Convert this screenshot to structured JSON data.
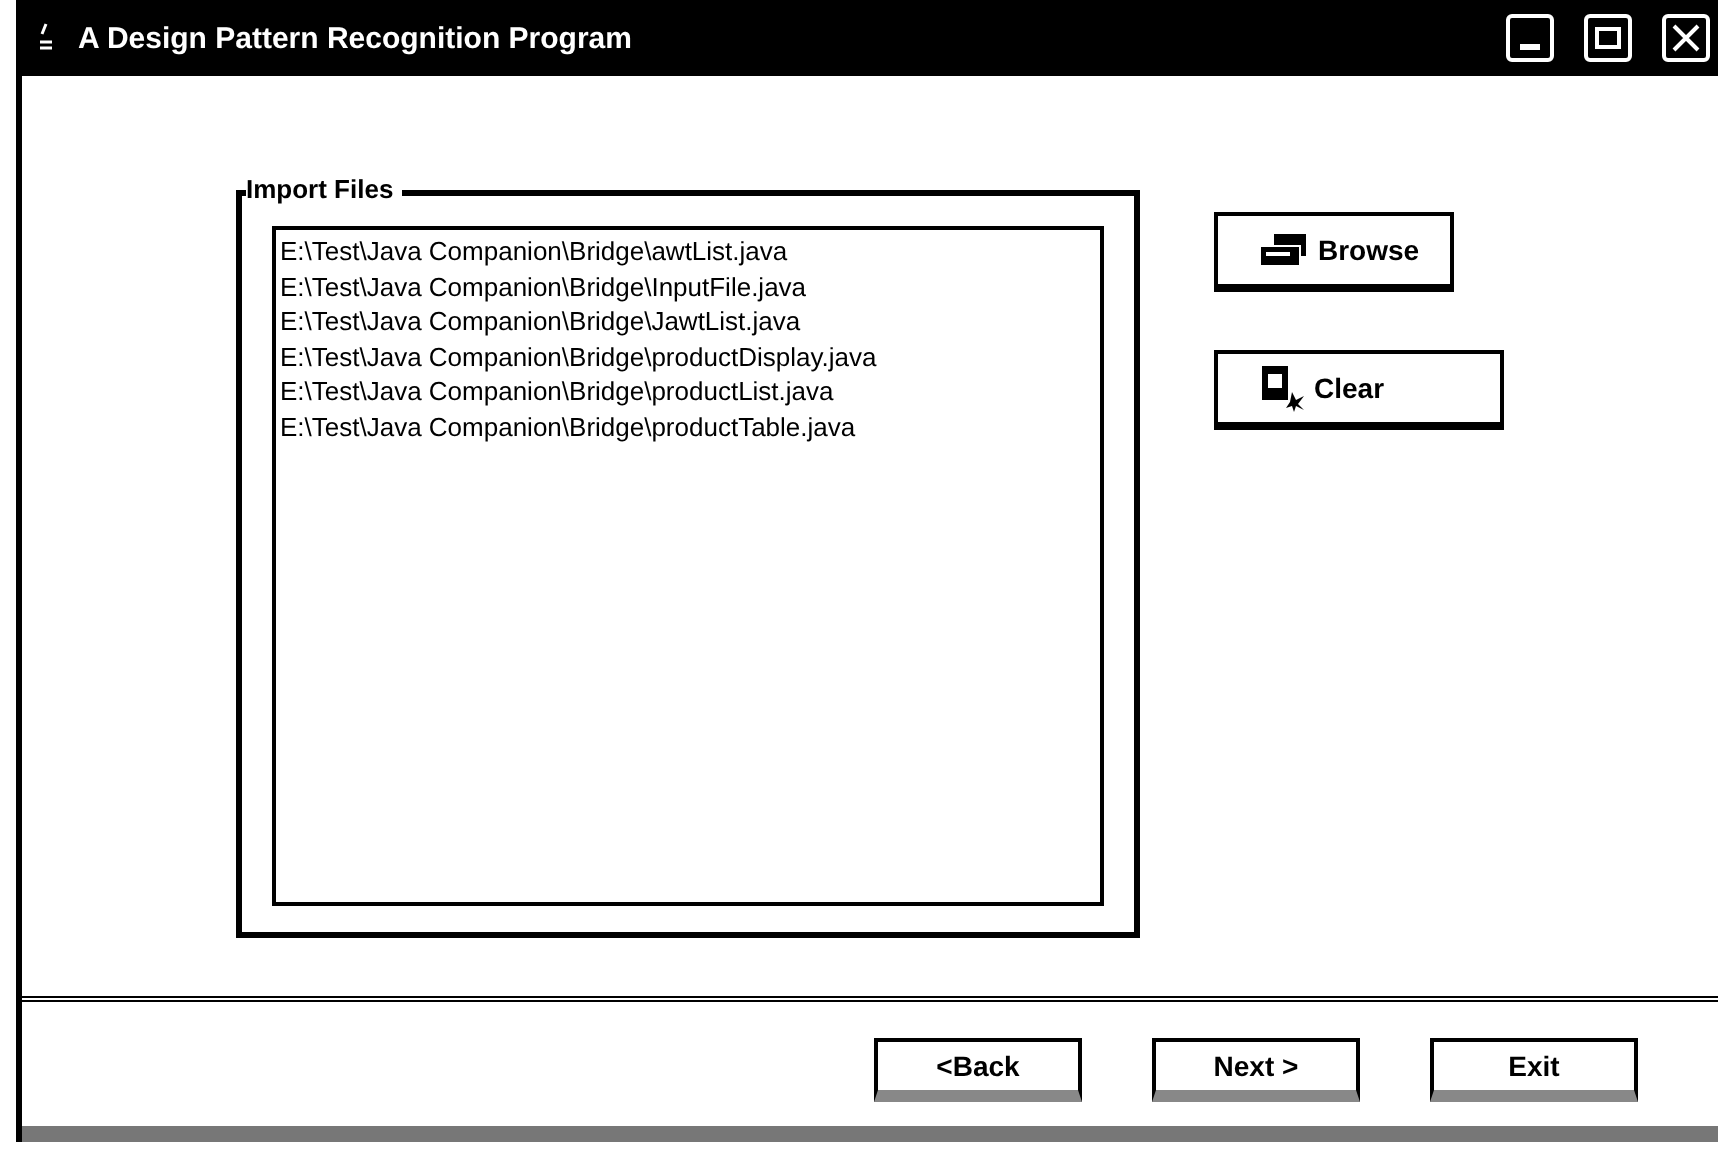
{
  "window": {
    "title": "A Design Pattern Recognition Program"
  },
  "import_files": {
    "label": "Import Files",
    "files": [
      "E:\\Test\\Java Companion\\Bridge\\awtList.java",
      "E:\\Test\\Java Companion\\Bridge\\InputFile.java",
      "E:\\Test\\Java Companion\\Bridge\\JawtList.java",
      "E:\\Test\\Java Companion\\Bridge\\productDisplay.java",
      "E:\\Test\\Java Companion\\Bridge\\productList.java",
      "E:\\Test\\Java Companion\\Bridge\\productTable.java"
    ]
  },
  "side_buttons": [
    {
      "label": "Browse",
      "kind": "browse"
    },
    {
      "label": "Clear",
      "kind": "clear"
    }
  ],
  "nav_buttons": [
    "<Back",
    "Next >",
    "Exit"
  ]
}
